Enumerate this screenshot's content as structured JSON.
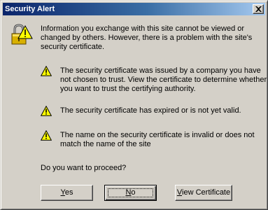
{
  "window": {
    "title": "Security Alert"
  },
  "intro": {
    "line1": "Information you exchange with this site cannot be viewed or",
    "line2": "changed by others. However, there is a problem with the site's",
    "line3": "security certificate."
  },
  "warnings": [
    {
      "line1": "The security certificate was issued by a company you have",
      "line2": "not chosen to trust. View the certificate to determine whether",
      "line3": "you want to trust the certifying authority."
    },
    {
      "line1": "The security certificate has expired or is not yet valid."
    },
    {
      "line1": "The name on the security certificate is invalid or does not",
      "line2": "match the name of the site"
    }
  ],
  "question": "Do you want to proceed?",
  "buttons": {
    "yes_key": "Y",
    "yes_rest": "es",
    "no_key": "N",
    "no_rest": "o",
    "view_key": "V",
    "view_rest": "iew Certificate"
  },
  "icons": {
    "lock": "padlock-warning-icon",
    "warning": "warning-triangle-icon",
    "close": "close-icon"
  },
  "colors": {
    "title_start": "#0a246a",
    "title_end": "#a6caf0",
    "face": "#d4d0c8",
    "warning_yellow": "#ffff00"
  }
}
